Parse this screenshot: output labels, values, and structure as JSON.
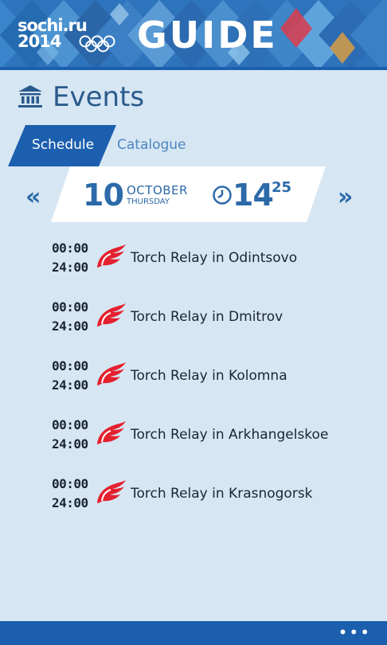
{
  "header": {
    "logo_line1": "sochi.ru",
    "logo_line2": "2014",
    "title": "GUIDE"
  },
  "page": {
    "title": "Events",
    "icon": "bank-icon"
  },
  "tabs": [
    {
      "label": "Schedule",
      "active": true
    },
    {
      "label": "Catalogue",
      "active": false
    }
  ],
  "date": {
    "day": "10",
    "month": "OCTOBER",
    "weekday": "THURSDAY",
    "hour": "14",
    "minute": "25",
    "prev": "«",
    "next": "»"
  },
  "events": [
    {
      "start": "00:00",
      "end": "24:00",
      "name": "Torch Relay in Odintsovo"
    },
    {
      "start": "00:00",
      "end": "24:00",
      "name": "Torch Relay in Dmitrov"
    },
    {
      "start": "00:00",
      "end": "24:00",
      "name": "Torch Relay in Kolomna"
    },
    {
      "start": "00:00",
      "end": "24:00",
      "name": "Torch Relay in Arkhangelskoe"
    },
    {
      "start": "00:00",
      "end": "24:00",
      "name": "Torch Relay in Krasnogorsk"
    }
  ],
  "appbar": {
    "more": "•••"
  },
  "colors": {
    "accent": "#1c5fae",
    "background": "#d6e6f3",
    "torch": "#e5202e"
  }
}
